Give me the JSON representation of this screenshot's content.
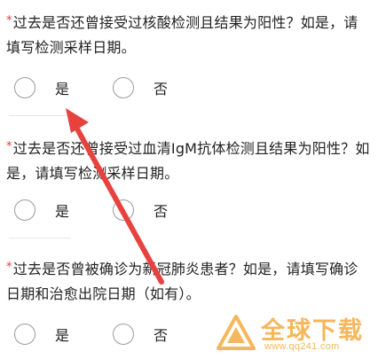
{
  "questions": [
    {
      "required_mark": "*",
      "text": "过去是否还曾接受过核酸检测且结果为阳性？如是，请填写检测采样日期。",
      "options": [
        "是",
        "否"
      ]
    },
    {
      "required_mark": "*",
      "text": "过去是否还曾接受过血清IgM抗体检测且结果为阳性？如是，请填写检测采样日期。",
      "options": [
        "是",
        "否"
      ]
    },
    {
      "required_mark": "*",
      "text": "过去是否曾被确诊为新冠肺炎患者？如是，请填写确诊日期和治愈出院日期（如有）。",
      "options": [
        "是",
        "否"
      ]
    }
  ],
  "annotation": {
    "arrow_color": "#e8423f"
  },
  "watermark": {
    "title": "全球下载",
    "url": "www.qq241.com",
    "color": "#f39a1d"
  }
}
